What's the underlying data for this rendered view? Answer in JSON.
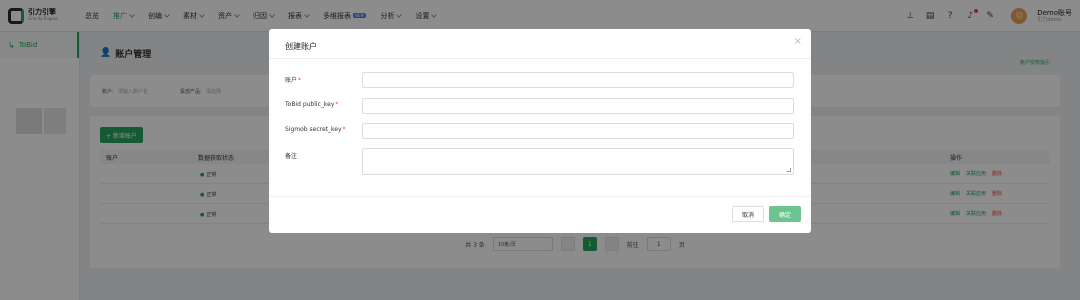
{
  "brand": {
    "name": "引力引擎",
    "sub": "Gravity Engine"
  },
  "nav": [
    {
      "label": "总览",
      "caret": false
    },
    {
      "label": "推广",
      "caret": true,
      "active": true
    },
    {
      "label": "创编",
      "caret": true
    },
    {
      "label": "素材",
      "caret": true
    },
    {
      "label": "资产",
      "caret": true
    },
    {
      "label": "归因",
      "caret": true
    },
    {
      "label": "报表",
      "caret": true
    },
    {
      "label": "多维报表",
      "caret": false,
      "badge": "NEW"
    },
    {
      "label": "分析",
      "caret": true
    },
    {
      "label": "设置",
      "caret": true
    }
  ],
  "account": {
    "avatar": "引",
    "name": "Demo账号",
    "sub": "引力demo"
  },
  "sidebar": {
    "item": "ToBid"
  },
  "page": {
    "title": "账户管理",
    "help": "账户授权指引"
  },
  "filters": [
    {
      "label": "账户:",
      "placeholder": "请输入账户名"
    },
    {
      "label": "投放产品:",
      "placeholder": "请选择"
    }
  ],
  "table": {
    "add_button": "+ 新增账户",
    "headers": [
      "账户",
      "数据获取状态",
      "操作"
    ],
    "rows": [
      {
        "status": "正常"
      },
      {
        "status": "正常"
      },
      {
        "status": "正常"
      }
    ],
    "ops": {
      "edit": "编辑",
      "link": "关联应用",
      "delete": "删除"
    }
  },
  "pager": {
    "total": "共 3 条",
    "page_size": "10条/页",
    "current": "1",
    "goto_label": "前往",
    "goto_value": "1",
    "page_suffix": "页"
  },
  "modal": {
    "title": "创建账户",
    "fields": [
      {
        "label": "账户",
        "required": "*"
      },
      {
        "label": "ToBid public_key",
        "required": "*"
      },
      {
        "label": "Sigmob secret_key",
        "required": "*"
      },
      {
        "label": "备注",
        "required": ""
      }
    ],
    "cancel": "取消",
    "confirm": "确定"
  }
}
